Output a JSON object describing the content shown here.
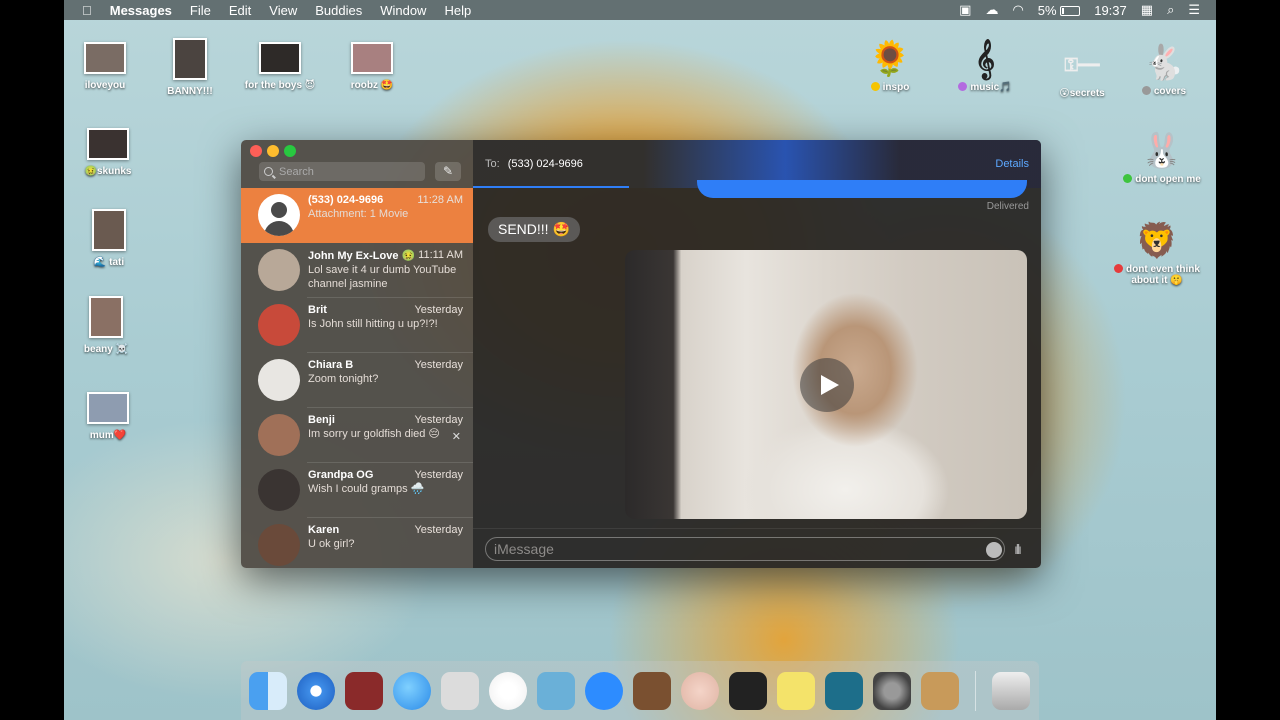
{
  "menubar": {
    "apple": "",
    "app": "Messages",
    "items": [
      "File",
      "Edit",
      "View",
      "Buddies",
      "Window",
      "Help"
    ],
    "battery": "5%",
    "time": "19:37"
  },
  "desktop": {
    "icons": [
      {
        "label": "iloveyou"
      },
      {
        "label": "BANNY!!!"
      },
      {
        "label": "for the boys 😈"
      },
      {
        "label": "roobz 🤩"
      },
      {
        "label": "skunks",
        "prefix": "🤢"
      },
      {
        "label": "tati",
        "prefix": "🌊"
      },
      {
        "label": "beany ☠️"
      },
      {
        "label": "mum❤️"
      },
      {
        "label": "inspo",
        "glyph": "🌻"
      },
      {
        "label": "music🎵",
        "glyph": "𝄞"
      },
      {
        "label": "secrets",
        "prefix": "😮"
      },
      {
        "label": "covers",
        "glyph": "🐇"
      },
      {
        "label": "dont open me",
        "glyph": "🐰"
      },
      {
        "label": "dont even think about it 🤫",
        "glyph": "🦁"
      }
    ]
  },
  "sidebar": {
    "search_placeholder": "Search",
    "conversations": [
      {
        "name": "(533) 024-9696",
        "time": "11:28 AM",
        "preview": "Attachment: 1 Movie"
      },
      {
        "name": "John My Ex-Love 🤢",
        "time": "11:11 AM",
        "preview": "Lol save it 4 ur dumb YouTube channel jasmine"
      },
      {
        "name": "Brit",
        "time": "Yesterday",
        "preview": "Is John still hitting u up?!?!"
      },
      {
        "name": "Chiara B",
        "time": "Yesterday",
        "preview": "Zoom tonight?"
      },
      {
        "name": "Benji",
        "time": "Yesterday",
        "preview": "Im sorry ur goldfish died 😔"
      },
      {
        "name": "Grandpa OG",
        "time": "Yesterday",
        "preview": "Wish I could gramps 🌧️"
      },
      {
        "name": "Karen",
        "time": "Yesterday",
        "preview": "U ok girl?"
      }
    ]
  },
  "chat": {
    "to_label": "To:",
    "recipient": "(533) 024-9696",
    "details": "Details",
    "delivered": "Delivered",
    "received_message": "SEND!!! 🤩",
    "input_placeholder": "iMessage"
  },
  "colors": {
    "accent_selected": "#ec8140",
    "imessage_blue": "#2f7ef7"
  }
}
